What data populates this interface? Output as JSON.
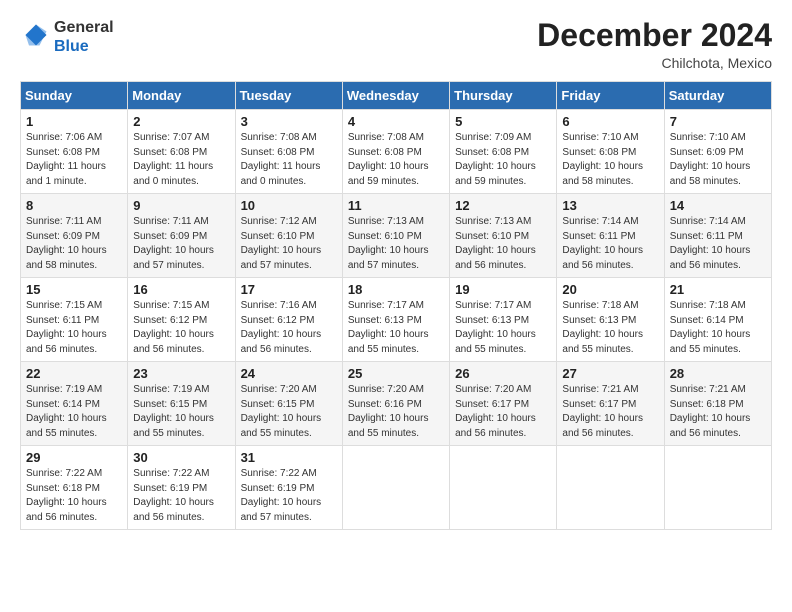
{
  "logo": {
    "line1": "General",
    "line2": "Blue"
  },
  "title": "December 2024",
  "location": "Chilchota, Mexico",
  "days_header": [
    "Sunday",
    "Monday",
    "Tuesday",
    "Wednesday",
    "Thursday",
    "Friday",
    "Saturday"
  ],
  "weeks": [
    [
      {
        "day": "1",
        "lines": [
          "Sunrise: 7:06 AM",
          "Sunset: 6:08 PM",
          "Daylight: 11 hours",
          "and 1 minute."
        ]
      },
      {
        "day": "2",
        "lines": [
          "Sunrise: 7:07 AM",
          "Sunset: 6:08 PM",
          "Daylight: 11 hours",
          "and 0 minutes."
        ]
      },
      {
        "day": "3",
        "lines": [
          "Sunrise: 7:08 AM",
          "Sunset: 6:08 PM",
          "Daylight: 11 hours",
          "and 0 minutes."
        ]
      },
      {
        "day": "4",
        "lines": [
          "Sunrise: 7:08 AM",
          "Sunset: 6:08 PM",
          "Daylight: 10 hours",
          "and 59 minutes."
        ]
      },
      {
        "day": "5",
        "lines": [
          "Sunrise: 7:09 AM",
          "Sunset: 6:08 PM",
          "Daylight: 10 hours",
          "and 59 minutes."
        ]
      },
      {
        "day": "6",
        "lines": [
          "Sunrise: 7:10 AM",
          "Sunset: 6:08 PM",
          "Daylight: 10 hours",
          "and 58 minutes."
        ]
      },
      {
        "day": "7",
        "lines": [
          "Sunrise: 7:10 AM",
          "Sunset: 6:09 PM",
          "Daylight: 10 hours",
          "and 58 minutes."
        ]
      }
    ],
    [
      {
        "day": "8",
        "lines": [
          "Sunrise: 7:11 AM",
          "Sunset: 6:09 PM",
          "Daylight: 10 hours",
          "and 58 minutes."
        ]
      },
      {
        "day": "9",
        "lines": [
          "Sunrise: 7:11 AM",
          "Sunset: 6:09 PM",
          "Daylight: 10 hours",
          "and 57 minutes."
        ]
      },
      {
        "day": "10",
        "lines": [
          "Sunrise: 7:12 AM",
          "Sunset: 6:10 PM",
          "Daylight: 10 hours",
          "and 57 minutes."
        ]
      },
      {
        "day": "11",
        "lines": [
          "Sunrise: 7:13 AM",
          "Sunset: 6:10 PM",
          "Daylight: 10 hours",
          "and 57 minutes."
        ]
      },
      {
        "day": "12",
        "lines": [
          "Sunrise: 7:13 AM",
          "Sunset: 6:10 PM",
          "Daylight: 10 hours",
          "and 56 minutes."
        ]
      },
      {
        "day": "13",
        "lines": [
          "Sunrise: 7:14 AM",
          "Sunset: 6:11 PM",
          "Daylight: 10 hours",
          "and 56 minutes."
        ]
      },
      {
        "day": "14",
        "lines": [
          "Sunrise: 7:14 AM",
          "Sunset: 6:11 PM",
          "Daylight: 10 hours",
          "and 56 minutes."
        ]
      }
    ],
    [
      {
        "day": "15",
        "lines": [
          "Sunrise: 7:15 AM",
          "Sunset: 6:11 PM",
          "Daylight: 10 hours",
          "and 56 minutes."
        ]
      },
      {
        "day": "16",
        "lines": [
          "Sunrise: 7:15 AM",
          "Sunset: 6:12 PM",
          "Daylight: 10 hours",
          "and 56 minutes."
        ]
      },
      {
        "day": "17",
        "lines": [
          "Sunrise: 7:16 AM",
          "Sunset: 6:12 PM",
          "Daylight: 10 hours",
          "and 56 minutes."
        ]
      },
      {
        "day": "18",
        "lines": [
          "Sunrise: 7:17 AM",
          "Sunset: 6:13 PM",
          "Daylight: 10 hours",
          "and 55 minutes."
        ]
      },
      {
        "day": "19",
        "lines": [
          "Sunrise: 7:17 AM",
          "Sunset: 6:13 PM",
          "Daylight: 10 hours",
          "and 55 minutes."
        ]
      },
      {
        "day": "20",
        "lines": [
          "Sunrise: 7:18 AM",
          "Sunset: 6:13 PM",
          "Daylight: 10 hours",
          "and 55 minutes."
        ]
      },
      {
        "day": "21",
        "lines": [
          "Sunrise: 7:18 AM",
          "Sunset: 6:14 PM",
          "Daylight: 10 hours",
          "and 55 minutes."
        ]
      }
    ],
    [
      {
        "day": "22",
        "lines": [
          "Sunrise: 7:19 AM",
          "Sunset: 6:14 PM",
          "Daylight: 10 hours",
          "and 55 minutes."
        ]
      },
      {
        "day": "23",
        "lines": [
          "Sunrise: 7:19 AM",
          "Sunset: 6:15 PM",
          "Daylight: 10 hours",
          "and 55 minutes."
        ]
      },
      {
        "day": "24",
        "lines": [
          "Sunrise: 7:20 AM",
          "Sunset: 6:15 PM",
          "Daylight: 10 hours",
          "and 55 minutes."
        ]
      },
      {
        "day": "25",
        "lines": [
          "Sunrise: 7:20 AM",
          "Sunset: 6:16 PM",
          "Daylight: 10 hours",
          "and 55 minutes."
        ]
      },
      {
        "day": "26",
        "lines": [
          "Sunrise: 7:20 AM",
          "Sunset: 6:17 PM",
          "Daylight: 10 hours",
          "and 56 minutes."
        ]
      },
      {
        "day": "27",
        "lines": [
          "Sunrise: 7:21 AM",
          "Sunset: 6:17 PM",
          "Daylight: 10 hours",
          "and 56 minutes."
        ]
      },
      {
        "day": "28",
        "lines": [
          "Sunrise: 7:21 AM",
          "Sunset: 6:18 PM",
          "Daylight: 10 hours",
          "and 56 minutes."
        ]
      }
    ],
    [
      {
        "day": "29",
        "lines": [
          "Sunrise: 7:22 AM",
          "Sunset: 6:18 PM",
          "Daylight: 10 hours",
          "and 56 minutes."
        ]
      },
      {
        "day": "30",
        "lines": [
          "Sunrise: 7:22 AM",
          "Sunset: 6:19 PM",
          "Daylight: 10 hours",
          "and 56 minutes."
        ]
      },
      {
        "day": "31",
        "lines": [
          "Sunrise: 7:22 AM",
          "Sunset: 6:19 PM",
          "Daylight: 10 hours",
          "and 57 minutes."
        ]
      },
      null,
      null,
      null,
      null
    ]
  ]
}
